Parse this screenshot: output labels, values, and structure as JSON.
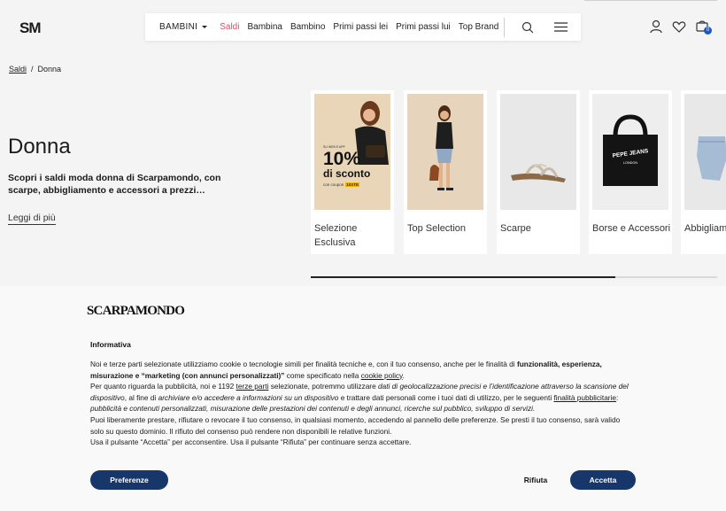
{
  "header": {
    "logo": "SM",
    "category": "BAMBINI",
    "nav_links": [
      "Saldi",
      "Bambina",
      "Bambino",
      "Primi passi lei",
      "Primi passi lui",
      "Top Brand"
    ],
    "cart_count": "0",
    "accent_color": "#d94d6a"
  },
  "breadcrumb": {
    "parent": "Saldi",
    "separator": "/",
    "current": "Donna"
  },
  "hero": {
    "title": "Donna",
    "description": "Scopri i saldi moda donna di Scarpamondo, con scarpe, abbigliamento e accessori a prezzi…",
    "read_more": "Leggi di più"
  },
  "promo": {
    "line1": "10%",
    "line2": "di sconto",
    "coupon_prefix": "con coupon",
    "coupon_code": "10XTE",
    "top_text": "SU WEB E APP"
  },
  "cards": [
    {
      "label": "Selezione Esclusiva"
    },
    {
      "label": "Top Selection"
    },
    {
      "label": "Scarpe"
    },
    {
      "label": "Borse e Accessori"
    },
    {
      "label": "Abbigliamento"
    }
  ],
  "bag_brand": {
    "line1": "PEPE JEANS",
    "line2": "LONDON"
  },
  "slider": {
    "progress": 0.75
  },
  "cookie": {
    "logo": "SCARPAMONDO",
    "title": "Informativa",
    "p1_a": "Noi e terze parti selezionate utilizziamo cookie o tecnologie simili per finalità tecniche e, con il tuo consenso, anche per le finalità di ",
    "p1_b": "funzionalità, esperienza, misurazione e “marketing (con annunci personalizzati)”",
    "p1_c": " come specificato nella ",
    "p1_link": "cookie policy",
    "p1_d": ".",
    "p2_a": "Per quanto riguarda la pubblicità, noi e 1192 ",
    "p2_link1": "terze parti",
    "p2_b": " selezionate, potremmo utilizzare ",
    "p2_i1": "dati di geolocalizzazione precisi e l’identificazione attraverso la scansione del dispositivo",
    "p2_c": ", al fine di ",
    "p2_i2": "archiviare e/o accedere a informazioni su un dispositivo",
    "p2_d": " e trattare dati personali come i tuoi dati di utilizzo, per le seguenti ",
    "p2_link2": "finalità pubblicitarie",
    "p2_e": ": ",
    "p2_i3": "pubblicità e contenuti personalizzati, misurazione delle prestazioni dei contenuti e degli annunci, ricerche sul pubblico, sviluppo di servizi.",
    "p3": "Puoi liberamente prestare, rifiutare o revocare il tuo consenso, in qualsiasi momento, accedendo al pannello delle preferenze. Se presti il tuo consenso, sarà valido solo su questo dominio. Il rifiuto del consenso può rendere non disponibili le relative funzioni.",
    "p4": "Usa il pulsante “Accetta” per acconsentire. Usa il pulsante “Rifiuta” per continuare senza accettare.",
    "btn_preferences": "Preferenze",
    "btn_reject": "Rifiuta",
    "btn_accept": "Accetta",
    "button_color": "#17376b"
  }
}
